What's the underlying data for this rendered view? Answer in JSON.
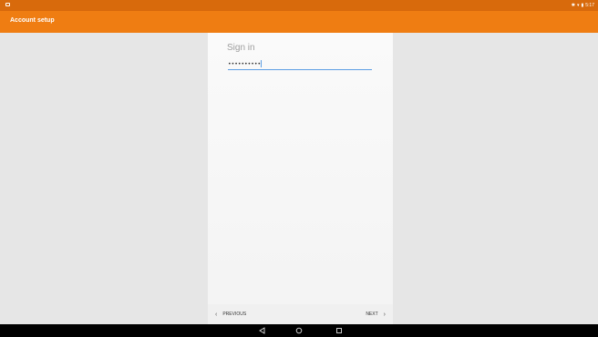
{
  "status_bar": {
    "notification_icon": "notification-icon",
    "bluetooth_icon": "bluetooth-icon",
    "wifi_icon": "wifi-icon",
    "battery_icon": "battery-icon",
    "time": "5:17"
  },
  "app_bar": {
    "title": "Account setup",
    "color": "#ef7d12"
  },
  "sign_in": {
    "heading": "Sign in",
    "password_value": "••••••••••"
  },
  "navigation": {
    "previous_label": "PREVIOUS",
    "next_label": "NEXT"
  },
  "system_nav": {
    "back_icon": "back-triangle-icon",
    "home_icon": "home-circle-icon",
    "recents_icon": "recents-square-icon"
  }
}
